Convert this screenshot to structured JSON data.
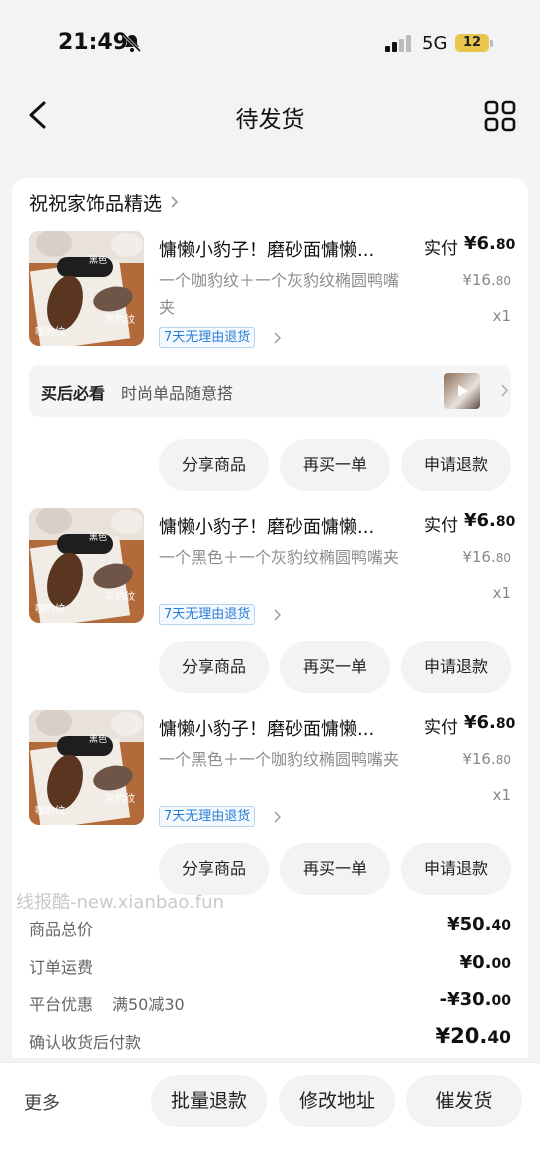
{
  "status_bar": {
    "time": "21:49",
    "network": "5G",
    "battery": "12"
  },
  "nav": {
    "title": "待发货"
  },
  "shop": {
    "name": "祝祝家饰品精选"
  },
  "items": [
    {
      "title": "慵懒小豹子！磨砂面慵懒...",
      "spec": "一个咖豹纹＋一个灰豹纹椭圆鸭嘴夹",
      "paid_label": "实付",
      "paid_int": "¥6.",
      "paid_dec": "80",
      "orig_int": "¥16.",
      "orig_dec": "80",
      "qty": "x1",
      "tag": "7天无理由退货",
      "thumb_labels": [
        "黑色",
        "咖豹纹",
        "灰豹纹"
      ]
    },
    {
      "title": "慵懒小豹子！磨砂面慵懒...",
      "spec": "一个黑色＋一个灰豹纹椭圆鸭嘴夹",
      "paid_label": "实付",
      "paid_int": "¥6.",
      "paid_dec": "80",
      "orig_int": "¥16.",
      "orig_dec": "80",
      "qty": "x1",
      "tag": "7天无理由退货",
      "thumb_labels": [
        "黑色",
        "咖豹纹",
        "灰豹纹"
      ]
    },
    {
      "title": "慵懒小豹子！磨砂面慵懒...",
      "spec": "一个黑色＋一个咖豹纹椭圆鸭嘴夹",
      "paid_label": "实付",
      "paid_int": "¥6.",
      "paid_dec": "80",
      "orig_int": "¥16.",
      "orig_dec": "80",
      "qty": "x1",
      "tag": "7天无理由退货",
      "thumb_labels": [
        "黑色",
        "咖豹纹",
        "灰豹纹"
      ]
    }
  ],
  "promo": {
    "title": "买后必看",
    "text": "时尚单品随意搭"
  },
  "item_actions": {
    "share": "分享商品",
    "rebuy": "再买一单",
    "refund": "申请退款"
  },
  "watermark": "线报酷-new.xianbao.fun",
  "summary": {
    "goods_total_label": "商品总价",
    "goods_total_int": "¥50.",
    "goods_total_dec": "40",
    "shipping_label": "订单运费",
    "shipping_int": "¥0.",
    "shipping_dec": "00",
    "discount_label": "平台优惠",
    "discount_sub": "满50减30",
    "discount_int": "-¥30.",
    "discount_dec": "00",
    "pay_label": "确认收货后付款",
    "pay_int": "¥20.",
    "pay_dec": "40"
  },
  "bottom_bar": {
    "more": "更多",
    "batch_refund": "批量退款",
    "change_address": "修改地址",
    "urge_ship": "催发货"
  },
  "icons": {
    "bell": "bell-mute-icon",
    "signal": "signal-icon",
    "back": "chevron-left-icon",
    "grid": "grid-icon",
    "play": "play-icon"
  },
  "colors": {
    "tag_blue": "#2a7fd4",
    "battery_yellow": "#e9c64a",
    "background": "#f2f3f5"
  }
}
